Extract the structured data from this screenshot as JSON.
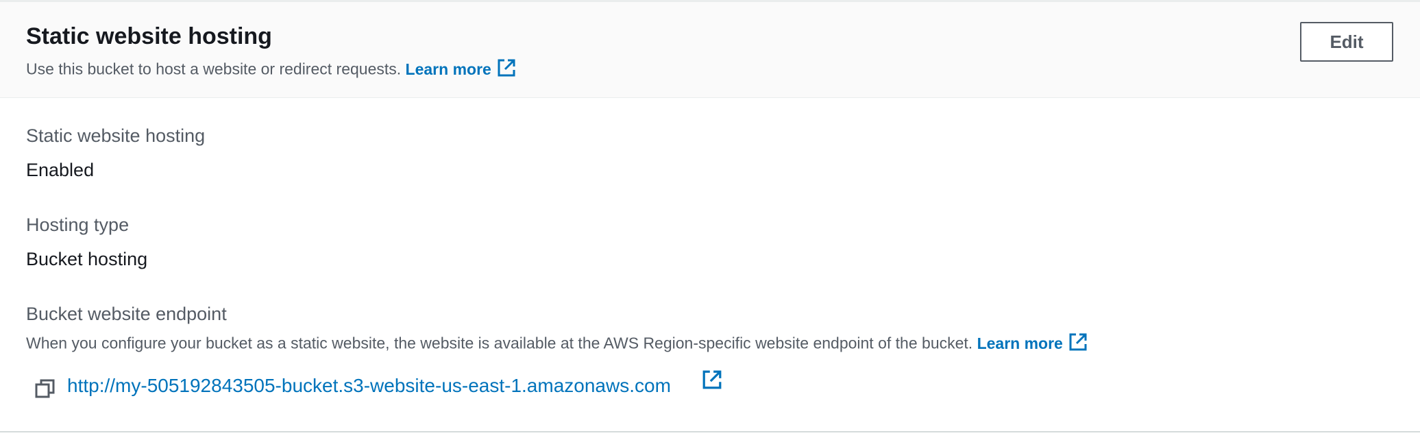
{
  "header": {
    "title": "Static website hosting",
    "description": "Use this bucket to host a website or redirect requests.",
    "learn_more": "Learn more",
    "edit_label": "Edit"
  },
  "fields": {
    "static_hosting": {
      "label": "Static website hosting",
      "value": "Enabled"
    },
    "hosting_type": {
      "label": "Hosting type",
      "value": "Bucket hosting"
    },
    "endpoint": {
      "label": "Bucket website endpoint",
      "description": "When you configure your bucket as a static website, the website is available at the AWS Region-specific website endpoint of the bucket.",
      "learn_more": "Learn more",
      "url": "http://my-505192843505-bucket.s3-website-us-east-1.amazonaws.com"
    }
  },
  "icons": {
    "external_link": "external-link-icon",
    "copy": "copy-icon"
  },
  "colors": {
    "link": "#0073bb",
    "header_bg": "#fafafa",
    "label": "#545b64",
    "text": "#16191f"
  }
}
